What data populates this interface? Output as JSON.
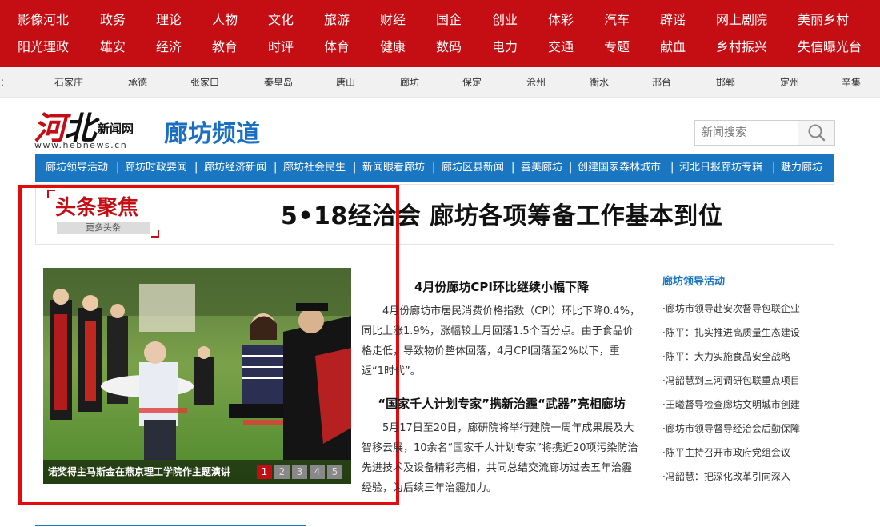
{
  "top_nav": {
    "row1": [
      "影像河北",
      "政务",
      "理论",
      "人物",
      "文化",
      "旅游",
      "财经",
      "国企",
      "创业",
      "体彩",
      "汽车",
      "辟谣",
      "网上剧院",
      "美丽乡村"
    ],
    "row2": [
      "阳光理政",
      "雄安",
      "经济",
      "教育",
      "时评",
      "体育",
      "健康",
      "数码",
      "电力",
      "交通",
      "专题",
      "献血",
      "乡村振兴",
      "失信曝光台"
    ]
  },
  "city_bar": {
    "lead": "：",
    "cities": [
      "石家庄",
      "承德",
      "张家口",
      "秦皇岛",
      "唐山",
      "廊坊",
      "保定",
      "沧州",
      "衡水",
      "邢台",
      "邯郸",
      "定州",
      "辛集"
    ]
  },
  "logo": {
    "main_a": "河",
    "main_b": "北",
    "small": "新闻网",
    "url": "www.hebnews.cn"
  },
  "channel_title": "廊坊频道",
  "search": {
    "placeholder": "新闻搜索"
  },
  "sub_nav": [
    "廊坊领导活动",
    "廊坊时政要闻",
    "廊坊经济新闻",
    "廊坊社会民生",
    "新闻眼看廊坊",
    "廊坊区县新闻",
    "善美廊坊",
    "创建国家森林城市",
    "河北日报廊坊专辑",
    "魅力廊坊"
  ],
  "focus": {
    "badge_title": "头条聚焦",
    "badge_more": "更多头条",
    "headline": "5•18经洽会 廊坊各项筹备工作基本到位"
  },
  "slide": {
    "caption": "诺奖得主马斯金在燕京理工学院作主题演讲",
    "pages": [
      "1",
      "2",
      "3",
      "4",
      "5"
    ],
    "active_page": 1
  },
  "news": [
    {
      "title": "4月份廊坊CPI环比继续小幅下降",
      "body": "4月份廊坊市居民消费价格指数（CPI）环比下降0.4%，同比上涨1.9%，涨幅较上月回落1.5个百分点。由于食品价格走低，导致物价整体回落，4月CPI回落至2%以下，重返“1时代”。"
    },
    {
      "title": "“国家千人计划专家”携新治霾“武器”亮相廊坊",
      "body": "5月17日至20日，廊研院将举行建院一周年成果展及大智移云展，10余名“国家千人计划专家”将携近20项污染防治先进技术及设备精彩亮相，共同总结交流廊坊过去五年治霾经验，为后续三年治霾加力。"
    }
  ],
  "side": {
    "title": "廊坊领导活动",
    "items": [
      "·廊坊市领导赴安次督导包联企业",
      "·陈平：扎实推进高质量生态建设",
      "·陈平：大力实施食品安全战略",
      "·冯韶慧到三河调研包联重点项目",
      "·王曦督导检查廊坊文明城市创建",
      "·廊坊市领导督导经洽会后勤保障",
      "·陈平主持召开市政府党组会议",
      "·冯韶慧：把深化改革引向深入"
    ]
  },
  "colors": {
    "brand_red": "#c40e13",
    "nav_blue": "#1b76c2",
    "highlight_red": "#e30b0b"
  }
}
